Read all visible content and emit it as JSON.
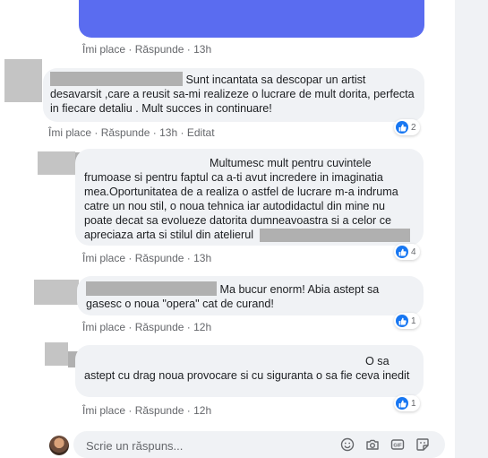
{
  "comments": [
    {
      "text": "Sunt incantata sa descopar un artist desavarsit ,care a reusit sa-mi realizeze o lucrare de mult dorita, perfecta in fiecare detaliu . Mult succes in continuare!",
      "like": "Îmi place",
      "reply": "Răspunde",
      "time": "13h",
      "edited": "Editat",
      "reactions": "2"
    },
    {
      "text": "Multumesc mult pentru cuvintele frumoase si pentru faptul ca a-ti avut incredere in imaginatia mea.Oportunitatea de a realiza o astfel de lucrare m-a indruma catre un nou stil, o noua tehnica iar autodidactul din mine nu poate decat sa evolueze datorita dumneavoastra si a celor ce apreciaza arta si stilul din atelierul",
      "like": "Îmi place",
      "reply": "Răspunde",
      "time": "13h",
      "reactions": "4"
    },
    {
      "text": "Ma bucur enorm! Abia astept sa gasesc o noua \"opera\" cat de curand!",
      "like": "Îmi place",
      "reply": "Răspunde",
      "time": "12h",
      "reactions": "1"
    },
    {
      "text": "O sa astept cu drag noua provocare si cu siguranta o sa fie ceva inedit",
      "like": "Îmi place",
      "reply": "Răspunde",
      "time": "12h",
      "reactions": "1"
    }
  ],
  "top_actions": {
    "like": "Îmi place",
    "reply": "Răspunde",
    "time": "13h"
  },
  "separator": "·",
  "composer": {
    "placeholder": "Scrie un răspuns..."
  },
  "colors": {
    "bubble": "#f0f2f5",
    "accent": "#1877f2",
    "meta_text": "#65676b",
    "image": "#5a6cf0"
  },
  "icons": [
    "thumbs-up-icon",
    "emoji-icon",
    "camera-icon",
    "gif-icon",
    "sticker-icon"
  ]
}
